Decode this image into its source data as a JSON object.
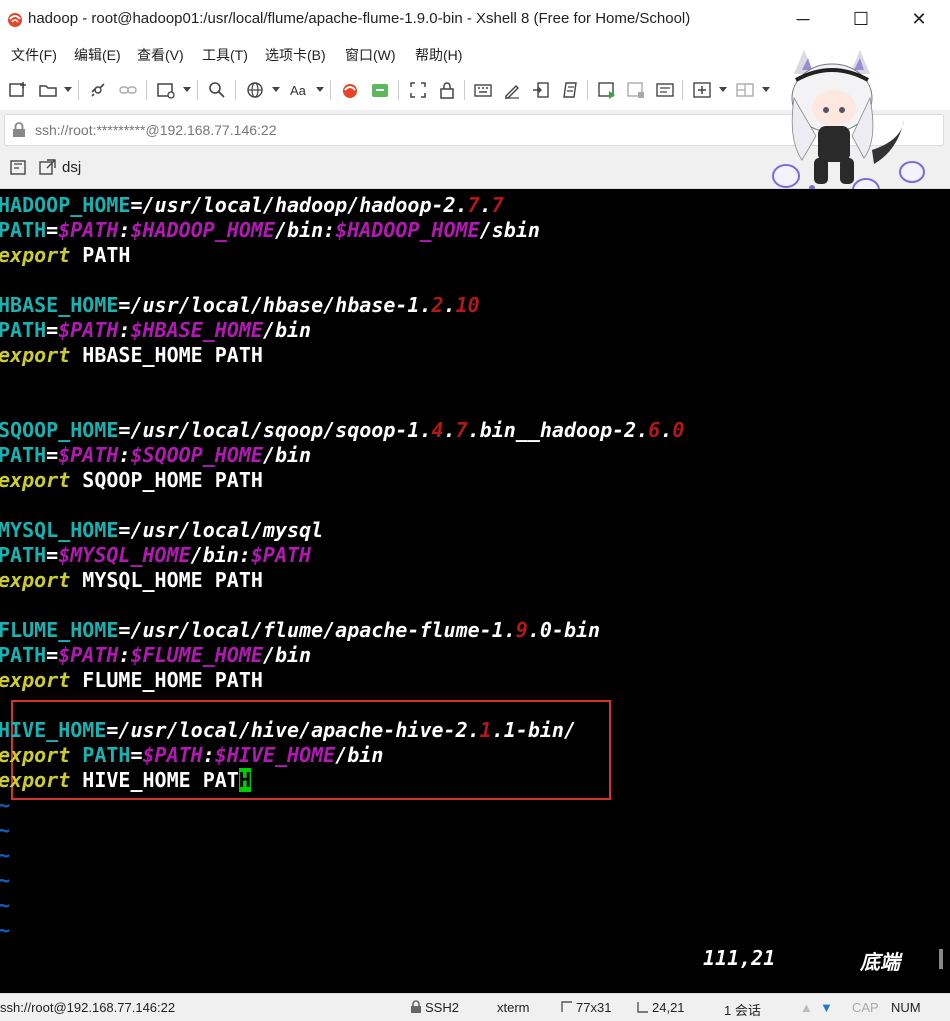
{
  "window": {
    "title": "hadoop - root@hadoop01:/usr/local/flume/apache-flume-1.9.0-bin - Xshell 8 (Free for Home/School)",
    "minimize": "─",
    "maximize": "☐",
    "close": "✕"
  },
  "menu": [
    "文件(F)",
    "编辑(E)",
    "查看(V)",
    "工具(T)",
    "选项卡(B)",
    "窗口(W)",
    "帮助(H)"
  ],
  "address": {
    "text": "ssh://root:*********@192.168.77.146:22"
  },
  "tab": {
    "label": "dsj"
  },
  "terminal": {
    "lines": [
      [
        [
          "var",
          "HADOOP_HOME"
        ],
        [
          "txt",
          "=/usr/local/hadoop/hadoop-2."
        ],
        [
          "num",
          "7"
        ],
        [
          "txt",
          "."
        ],
        [
          "num",
          "7"
        ]
      ],
      [
        [
          "var",
          "PATH"
        ],
        [
          "txt",
          "="
        ],
        [
          "pth",
          "$PATH"
        ],
        [
          "txt",
          ":"
        ],
        [
          "pth",
          "$HADOOP_HOME"
        ],
        [
          "txt",
          "/bin:"
        ],
        [
          "pth",
          "$HADOOP_HOME"
        ],
        [
          "txt",
          "/sbin"
        ]
      ],
      [
        [
          "exp",
          "export"
        ],
        [
          "plain",
          " PATH"
        ]
      ],
      [],
      [
        [
          "var",
          "HBASE_HOME"
        ],
        [
          "txt",
          "=/usr/local/hbase/hbase-1."
        ],
        [
          "num",
          "2"
        ],
        [
          "txt",
          "."
        ],
        [
          "num",
          "10"
        ]
      ],
      [
        [
          "var",
          "PATH"
        ],
        [
          "txt",
          "="
        ],
        [
          "pth",
          "$PATH"
        ],
        [
          "txt",
          ":"
        ],
        [
          "pth",
          "$HBASE_HOME"
        ],
        [
          "txt",
          "/bin"
        ]
      ],
      [
        [
          "exp",
          "export"
        ],
        [
          "plain",
          " HBASE_HOME PATH"
        ]
      ],
      [],
      [],
      [
        [
          "var",
          "SQOOP_HOME"
        ],
        [
          "txt",
          "=/usr/local/sqoop/sqoop-1."
        ],
        [
          "num",
          "4"
        ],
        [
          "txt",
          "."
        ],
        [
          "num",
          "7"
        ],
        [
          "txt",
          ".bin__hadoop-2."
        ],
        [
          "num",
          "6"
        ],
        [
          "txt",
          "."
        ],
        [
          "num",
          "0"
        ]
      ],
      [
        [
          "var",
          "PATH"
        ],
        [
          "txt",
          "="
        ],
        [
          "pth",
          "$PATH"
        ],
        [
          "txt",
          ":"
        ],
        [
          "pth",
          "$SQOOP_HOME"
        ],
        [
          "txt",
          "/bin"
        ]
      ],
      [
        [
          "exp",
          "export"
        ],
        [
          "plain",
          " SQOOP_HOME PATH"
        ]
      ],
      [],
      [
        [
          "var",
          "MYSQL_HOME"
        ],
        [
          "txt",
          "=/usr/local/mysql"
        ]
      ],
      [
        [
          "var",
          "PATH"
        ],
        [
          "txt",
          "="
        ],
        [
          "pth",
          "$MYSQL_HOME"
        ],
        [
          "txt",
          "/bin:"
        ],
        [
          "pth",
          "$PATH"
        ]
      ],
      [
        [
          "exp",
          "export"
        ],
        [
          "plain",
          " MYSQL_HOME PATH"
        ]
      ],
      [],
      [
        [
          "var",
          "FLUME_HOME"
        ],
        [
          "txt",
          "=/usr/local/flume/apache-flume-1."
        ],
        [
          "num",
          "9"
        ],
        [
          "txt",
          ".0-bin"
        ]
      ],
      [
        [
          "var",
          "PATH"
        ],
        [
          "txt",
          "="
        ],
        [
          "pth",
          "$PATH"
        ],
        [
          "txt",
          ":"
        ],
        [
          "pth",
          "$FLUME_HOME"
        ],
        [
          "txt",
          "/bin"
        ]
      ],
      [
        [
          "exp",
          "export"
        ],
        [
          "plain",
          " FLUME_HOME PATH"
        ]
      ],
      [],
      [
        [
          "var",
          "HIVE_HOME"
        ],
        [
          "txt",
          "=/usr/local/hive/apache-hive-2."
        ],
        [
          "num",
          "1"
        ],
        [
          "txt",
          ".1-bin/"
        ]
      ],
      [
        [
          "exp",
          "export"
        ],
        [
          "var",
          " PATH"
        ],
        [
          "txt",
          "="
        ],
        [
          "pth",
          "$PATH"
        ],
        [
          "txt",
          ":"
        ],
        [
          "pth",
          "$HIVE_HOME"
        ],
        [
          "txt",
          "/bin"
        ]
      ],
      [
        [
          "exp",
          "export"
        ],
        [
          "plain",
          " HIVE_HOME PAT"
        ],
        [
          "cursor",
          "H"
        ]
      ],
      [
        [
          "tilde",
          "~"
        ]
      ],
      [
        [
          "tilde",
          "~"
        ]
      ],
      [
        [
          "tilde",
          "~"
        ]
      ],
      [
        [
          "tilde",
          "~"
        ]
      ],
      [
        [
          "tilde",
          "~"
        ]
      ],
      [
        [
          "tilde",
          "~"
        ]
      ]
    ],
    "position": "111,21",
    "position_label": "底端"
  },
  "status": {
    "connection": "ssh://root@192.168.77.146:22",
    "protocol": "SSH2",
    "term": "xterm",
    "size": "77x31",
    "cursor": "24,21",
    "sessions": "1 会话",
    "cap": "CAP",
    "num": "NUM"
  }
}
